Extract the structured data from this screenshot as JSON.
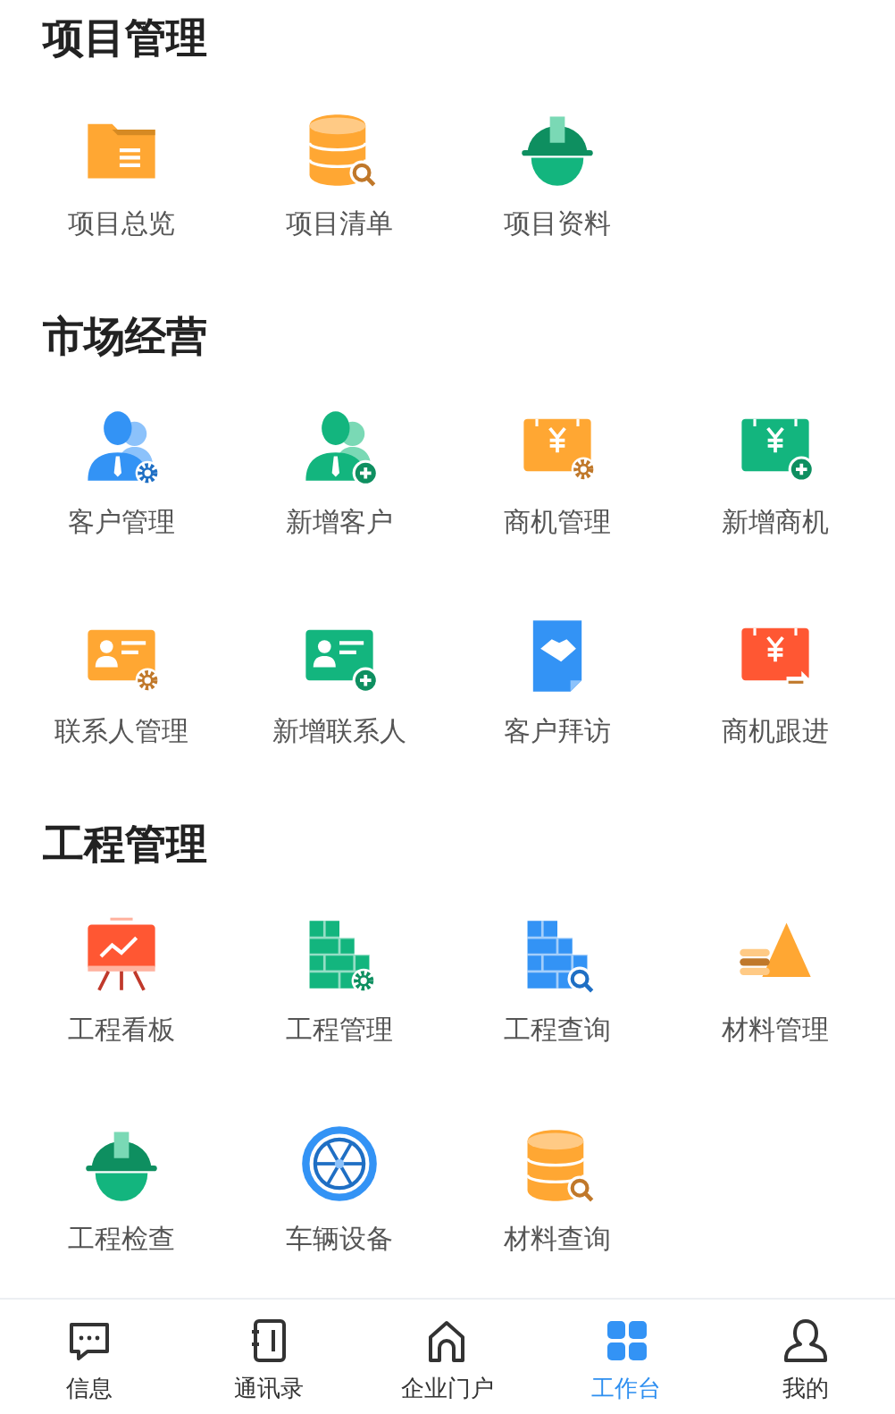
{
  "sections": [
    {
      "title": "项目管理",
      "items": [
        {
          "label": "项目总览"
        },
        {
          "label": "项目清单"
        },
        {
          "label": "项目资料"
        }
      ]
    },
    {
      "title": "市场经营",
      "items": [
        {
          "label": "客户管理"
        },
        {
          "label": "新增客户"
        },
        {
          "label": "商机管理"
        },
        {
          "label": "新增商机"
        },
        {
          "label": "联系人管理"
        },
        {
          "label": "新增联系人"
        },
        {
          "label": "客户拜访"
        },
        {
          "label": "商机跟进"
        }
      ]
    },
    {
      "title": "工程管理",
      "items": [
        {
          "label": "工程看板"
        },
        {
          "label": "工程管理"
        },
        {
          "label": "工程查询"
        },
        {
          "label": "材料管理"
        },
        {
          "label": "工程检查"
        },
        {
          "label": "车辆设备"
        },
        {
          "label": "材料查询"
        }
      ]
    }
  ],
  "tabbar": [
    {
      "label": "信息",
      "selected": false
    },
    {
      "label": "通讯录",
      "selected": false
    },
    {
      "label": "企业门户",
      "selected": false
    },
    {
      "label": "工作台",
      "selected": true
    },
    {
      "label": "我的",
      "selected": false
    }
  ]
}
